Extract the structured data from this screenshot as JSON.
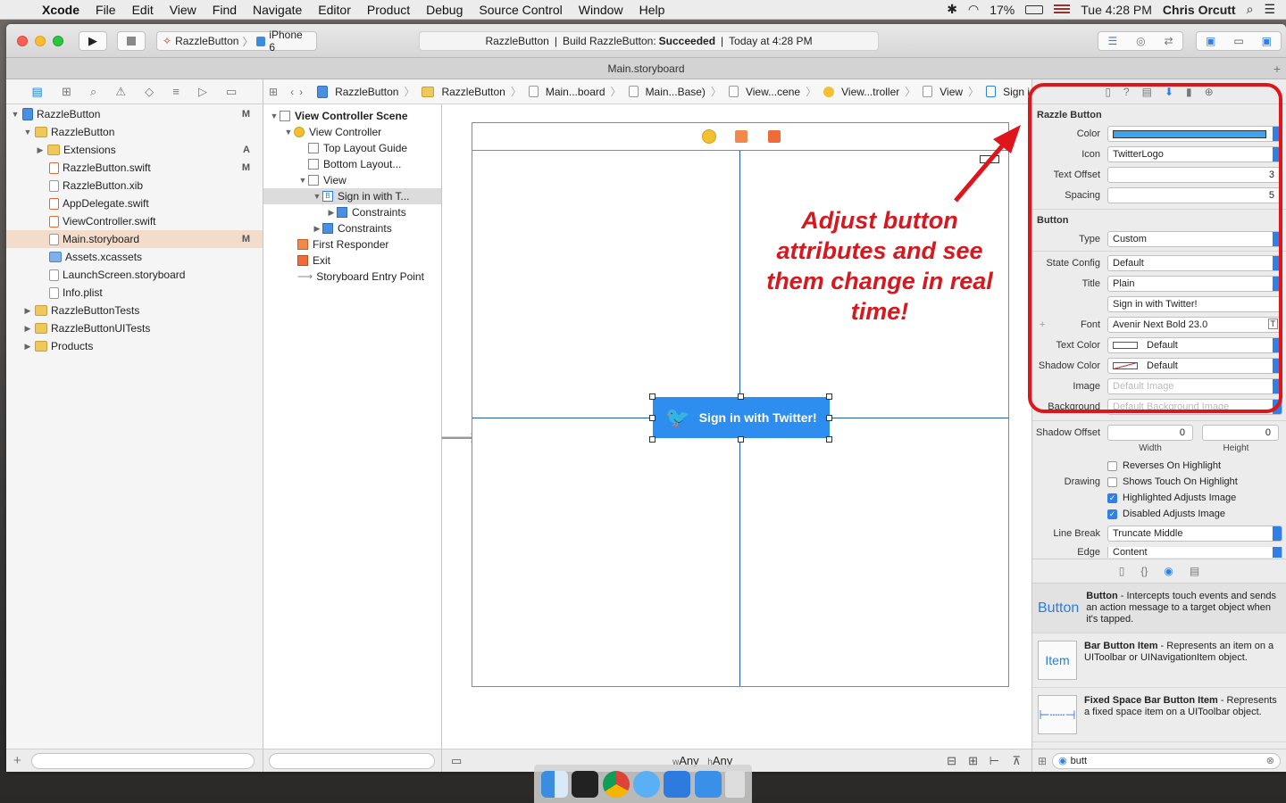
{
  "menubar": {
    "items": [
      "Xcode",
      "File",
      "Edit",
      "View",
      "Find",
      "Navigate",
      "Editor",
      "Product",
      "Debug",
      "Source Control",
      "Window",
      "Help"
    ],
    "battery": "17%",
    "clock": "Tue 4:28 PM",
    "user": "Chris Orcutt"
  },
  "toolbar": {
    "scheme": "RazzleButton",
    "device": "iPhone 6",
    "status_project": "RazzleButton",
    "status_build": "Build RazzleButton:",
    "status_result": "Succeeded",
    "status_time": "Today at 4:28 PM"
  },
  "tab_title": "Main.storyboard",
  "navigator": {
    "rows": [
      {
        "label": "RazzleButton",
        "badge": "M"
      },
      {
        "label": "RazzleButton",
        "badge": ""
      },
      {
        "label": "Extensions",
        "badge": "A"
      },
      {
        "label": "RazzleButton.swift",
        "badge": "M"
      },
      {
        "label": "RazzleButton.xib",
        "badge": ""
      },
      {
        "label": "AppDelegate.swift",
        "badge": ""
      },
      {
        "label": "ViewController.swift",
        "badge": ""
      },
      {
        "label": "Main.storyboard",
        "badge": "M"
      },
      {
        "label": "Assets.xcassets",
        "badge": ""
      },
      {
        "label": "LaunchScreen.storyboard",
        "badge": ""
      },
      {
        "label": "Info.plist",
        "badge": ""
      },
      {
        "label": "RazzleButtonTests",
        "badge": ""
      },
      {
        "label": "RazzleButtonUITests",
        "badge": ""
      },
      {
        "label": "Products",
        "badge": ""
      }
    ]
  },
  "jumpbar": [
    "RazzleButton",
    "RazzleButton",
    "Main...board",
    "Main...Base)",
    "View...cene",
    "View...troller",
    "View",
    "Sign in with Twitter!"
  ],
  "outline": {
    "scene": "View Controller Scene",
    "rows": [
      "View Controller",
      "Top Layout Guide",
      "Bottom Layout...",
      "View",
      "Sign in with T...",
      "Constraints",
      "Constraints",
      "First Responder",
      "Exit",
      "Storyboard Entry Point"
    ]
  },
  "canvas": {
    "button_title": "Sign in with Twitter!",
    "size_w_prefix": "w",
    "size_w": "Any",
    "size_h_prefix": "h",
    "size_h": "Any"
  },
  "annotation": "Adjust button attributes and see them change in real time!",
  "inspector": {
    "razzle_section": "Razzle Button",
    "color_label": "Color",
    "icon_label": "Icon",
    "icon_value": "TwitterLogo",
    "text_offset_label": "Text Offset",
    "text_offset_value": "3",
    "spacing_label": "Spacing",
    "spacing_value": "5",
    "button_section": "Button",
    "type_label": "Type",
    "type_value": "Custom",
    "state_label": "State Config",
    "state_value": "Default",
    "title_label": "Title",
    "title_value": "Plain",
    "title_text": "Sign in with Twitter!",
    "font_label": "Font",
    "font_value": "Avenir Next Bold 23.0",
    "text_color_label": "Text Color",
    "text_color_value": "Default",
    "shadow_color_label": "Shadow Color",
    "shadow_color_value": "Default",
    "image_label": "Image",
    "image_placeholder": "Default Image",
    "background_label": "Background",
    "background_placeholder": "Default Background Image",
    "shadow_offset_label": "Shadow Offset",
    "shadow_w": "0",
    "shadow_h": "0",
    "width_label": "Width",
    "height_label": "Height",
    "drawing_label": "Drawing",
    "checks": [
      {
        "label": "Reverses On Highlight",
        "on": false
      },
      {
        "label": "Shows Touch On Highlight",
        "on": false
      },
      {
        "label": "Highlighted Adjusts Image",
        "on": true
      },
      {
        "label": "Disabled Adjusts Image",
        "on": true
      }
    ],
    "line_break_label": "Line Break",
    "line_break_value": "Truncate Middle",
    "edge_label": "Edge",
    "edge_value": "Content"
  },
  "library": {
    "items": [
      {
        "icon": "Button",
        "name": "Button",
        "desc": " - Intercepts touch events and sends an action message to a target object when it's tapped."
      },
      {
        "icon": "Item",
        "name": "Bar Button Item",
        "desc": " - Represents an item on a UIToolbar or UINavigationItem object."
      },
      {
        "icon": "",
        "name": "Fixed Space Bar Button Item",
        "desc": " - Represents a fixed space item on a UIToolbar object."
      }
    ],
    "search_value": "butt"
  },
  "colors": {
    "accent": "#2f7fe6",
    "annotation": "#d8181f",
    "twitter": "#2d8ef0"
  }
}
